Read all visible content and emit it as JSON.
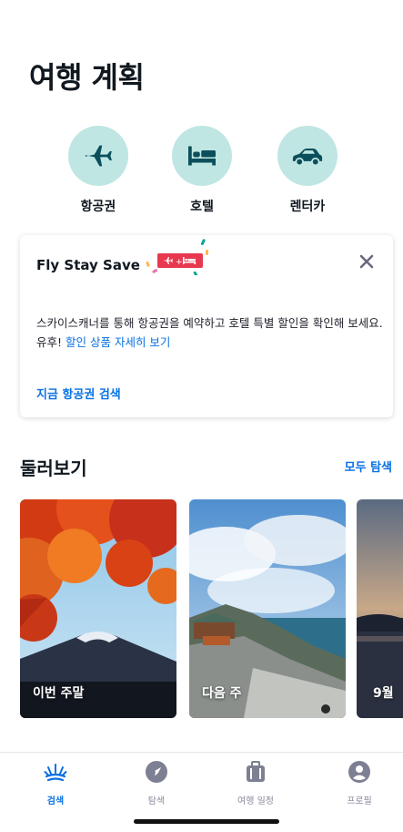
{
  "page": {
    "title": "여행 계획"
  },
  "quick_actions": [
    {
      "label": "항공권",
      "icon": "airplane-icon"
    },
    {
      "label": "호텔",
      "icon": "bed-icon"
    },
    {
      "label": "렌터카",
      "icon": "car-icon"
    }
  ],
  "promo": {
    "title": "Fly Stay Save",
    "badge_icon": "plane-plus-hotel-icon",
    "body_text": "스카이스캐너를 통해 항공권을 예약하고 호텔 특별 할인을 확인해 보세요. 유후! ",
    "body_link": "할인 상품 자세히 보기",
    "cta": "지금 항공권 검색"
  },
  "explore": {
    "title": "둘러보기",
    "see_all": "모두 탐색",
    "cards": [
      {
        "label": "이번 주말"
      },
      {
        "label": "다음 주"
      },
      {
        "label": "9월"
      }
    ]
  },
  "tabbar": {
    "tabs": [
      {
        "label": "검색",
        "icon": "sun-search-icon",
        "active": true
      },
      {
        "label": "탐색",
        "icon": "compass-icon",
        "active": false
      },
      {
        "label": "여행 일정",
        "icon": "suitcase-icon",
        "active": false
      },
      {
        "label": "프로필",
        "icon": "profile-icon",
        "active": false
      }
    ]
  },
  "colors": {
    "accent": "#0770e3",
    "icon_bg": "#bfe6e3",
    "icon_fg": "#0b4f5c",
    "badge": "#e8384f"
  }
}
